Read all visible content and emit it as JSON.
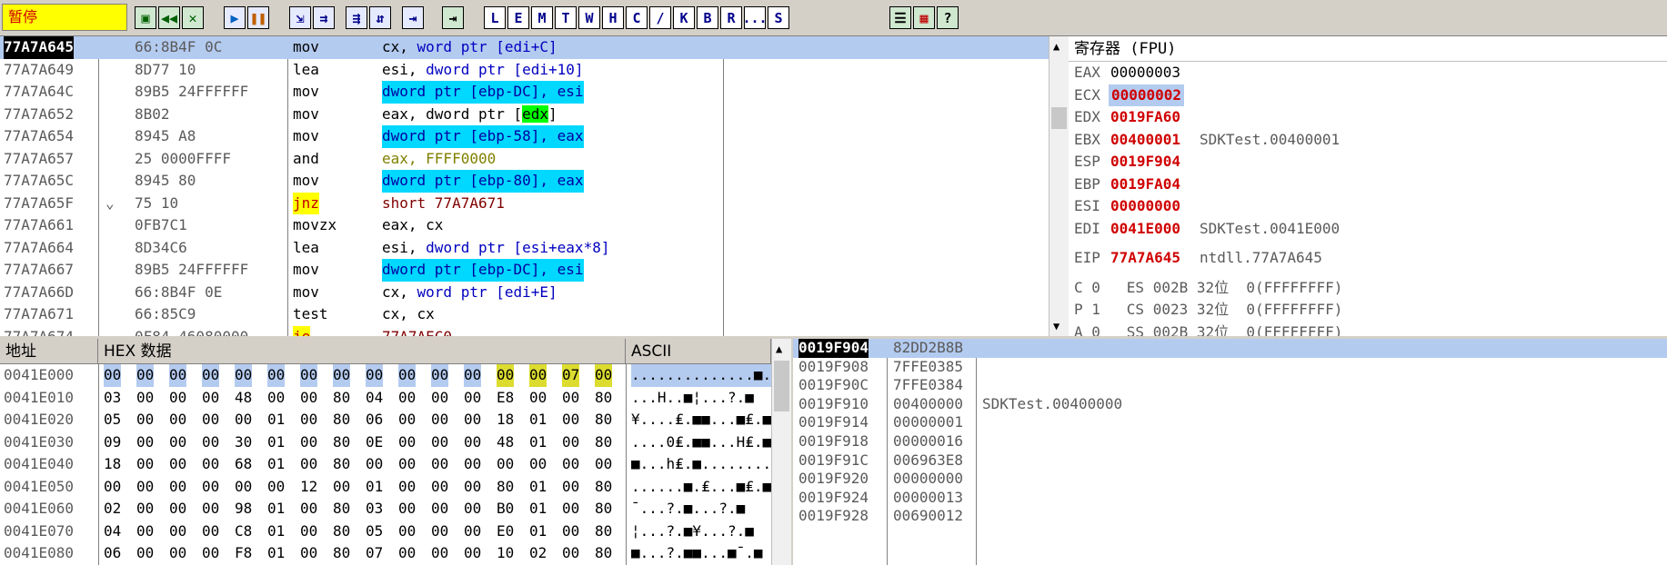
{
  "toolbar": {
    "status": "暂停",
    "buttons": [
      "L",
      "E",
      "M",
      "T",
      "W",
      "H",
      "C",
      "/",
      "K",
      "B",
      "R",
      "...",
      "S"
    ]
  },
  "disasm": {
    "rows": [
      {
        "addr": "77A7A645",
        "hex": "66:8B4F 0C",
        "mn": "mov",
        "op": "cx, word ptr [edi+C]"
      },
      {
        "addr": "77A7A649",
        "hex": "8D77 10",
        "mn": "lea",
        "op": "esi, dword ptr [edi+10]"
      },
      {
        "addr": "77A7A64C",
        "hex": "89B5 24FFFFFF",
        "mn": "mov",
        "op": "dword ptr [ebp-DC], esi"
      },
      {
        "addr": "77A7A652",
        "hex": "8B02",
        "mn": "mov",
        "op": "eax, dword ptr [edx]"
      },
      {
        "addr": "77A7A654",
        "hex": "8945 A8",
        "mn": "mov",
        "op": "dword ptr [ebp-58], eax"
      },
      {
        "addr": "77A7A657",
        "hex": "25 0000FFFF",
        "mn": "and",
        "op": "eax, FFFF0000"
      },
      {
        "addr": "77A7A65C",
        "hex": "8945 80",
        "mn": "mov",
        "op": "dword ptr [ebp-80], eax"
      },
      {
        "addr": "77A7A65F",
        "hex": "75 10",
        "mn": "jnz",
        "op": "short 77A7A671"
      },
      {
        "addr": "77A7A661",
        "hex": "0FB7C1",
        "mn": "movzx",
        "op": "eax, cx"
      },
      {
        "addr": "77A7A664",
        "hex": "8D34C6",
        "mn": "lea",
        "op": "esi, dword ptr [esi+eax*8]"
      },
      {
        "addr": "77A7A667",
        "hex": "89B5 24FFFFFF",
        "mn": "mov",
        "op": "dword ptr [ebp-DC], esi"
      },
      {
        "addr": "77A7A66D",
        "hex": "66:8B4F 0E",
        "mn": "mov",
        "op": "cx, word ptr [edi+E]"
      },
      {
        "addr": "77A7A671",
        "hex": "66:85C9",
        "mn": "test",
        "op": "cx, cx"
      },
      {
        "addr": "77A7A674",
        "hex": "0F84 46080000",
        "mn": "je",
        "op": "77A7AEC0"
      }
    ]
  },
  "registers": {
    "title": "寄存器 (FPU)",
    "eax": "EAX",
    "eax_v": "00000003",
    "ecx": "ECX",
    "ecx_v": "00000002",
    "edx": "EDX",
    "edx_v": "0019FA60",
    "ebx": "EBX",
    "ebx_v": "00400001",
    "ebx_c": "SDKTest.00400001",
    "esp": "ESP",
    "esp_v": "0019F904",
    "ebp": "EBP",
    "ebp_v": "0019FA04",
    "esi": "ESI",
    "esi_v": "00000000",
    "edi": "EDI",
    "edi_v": "0041E000",
    "edi_c": "SDKTest.0041E000",
    "eip": "EIP",
    "eip_v": "77A7A645",
    "eip_c": "ntdll.77A7A645",
    "seg1": "C 0   ES 002B 32位  0(FFFFFFFF)",
    "seg2": "P 1   CS 0023 32位  0(FFFFFFFF)",
    "seg3": "A 0   SS 002B 32位  0(FFFFFFFF)"
  },
  "dump": {
    "h_addr": "地址",
    "h_hex": "HEX 数据",
    "h_ascii": "ASCII",
    "rows": [
      {
        "a": "0041E000",
        "b": [
          "00",
          "00",
          "00",
          "00",
          "00",
          "00",
          "00",
          "00",
          "00",
          "00",
          "00",
          "00",
          "00",
          "00",
          "07",
          "00"
        ],
        "s": "..............■."
      },
      {
        "a": "0041E010",
        "b": [
          "03",
          "00",
          "00",
          "00",
          "48",
          "00",
          "00",
          "80",
          "04",
          "00",
          "00",
          "00",
          "E8",
          "00",
          "00",
          "80"
        ],
        "s": "...H..■¦...?.■"
      },
      {
        "a": "0041E020",
        "b": [
          "05",
          "00",
          "00",
          "00",
          "00",
          "01",
          "00",
          "80",
          "06",
          "00",
          "00",
          "00",
          "18",
          "01",
          "00",
          "80"
        ],
        "s": "¥....₤.■■...■₤.■"
      },
      {
        "a": "0041E030",
        "b": [
          "09",
          "00",
          "00",
          "00",
          "30",
          "01",
          "00",
          "80",
          "0E",
          "00",
          "00",
          "00",
          "48",
          "01",
          "00",
          "80"
        ],
        "s": "....0₤.■■...H₤.■"
      },
      {
        "a": "0041E040",
        "b": [
          "18",
          "00",
          "00",
          "00",
          "68",
          "01",
          "00",
          "80",
          "00",
          "00",
          "00",
          "00",
          "00",
          "00",
          "00",
          "00"
        ],
        "s": "■...h₤.■........"
      },
      {
        "a": "0041E050",
        "b": [
          "00",
          "00",
          "00",
          "00",
          "00",
          "00",
          "12",
          "00",
          "01",
          "00",
          "00",
          "00",
          "80",
          "01",
          "00",
          "80"
        ],
        "s": "......■.₤...■₤.■"
      },
      {
        "a": "0041E060",
        "b": [
          "02",
          "00",
          "00",
          "00",
          "98",
          "01",
          "00",
          "80",
          "03",
          "00",
          "00",
          "00",
          "B0",
          "01",
          "00",
          "80"
        ],
        "s": "¯...?.■...?.■"
      },
      {
        "a": "0041E070",
        "b": [
          "04",
          "00",
          "00",
          "00",
          "C8",
          "01",
          "00",
          "80",
          "05",
          "00",
          "00",
          "00",
          "E0",
          "01",
          "00",
          "80"
        ],
        "s": "¦...?.■¥...?.■"
      },
      {
        "a": "0041E080",
        "b": [
          "06",
          "00",
          "00",
          "00",
          "F8",
          "01",
          "00",
          "80",
          "07",
          "00",
          "00",
          "00",
          "10",
          "02",
          "00",
          "80"
        ],
        "s": "■...?.■■...■¯.■"
      }
    ]
  },
  "stack": {
    "rows": [
      {
        "a": "0019F904",
        "v": "82DD2B8B",
        "c": ""
      },
      {
        "a": "0019F908",
        "v": "7FFE0385",
        "c": ""
      },
      {
        "a": "0019F90C",
        "v": "7FFE0384",
        "c": ""
      },
      {
        "a": "0019F910",
        "v": "00400000",
        "c": "SDKTest.00400000"
      },
      {
        "a": "0019F914",
        "v": "00000001",
        "c": ""
      },
      {
        "a": "0019F918",
        "v": "00000016",
        "c": ""
      },
      {
        "a": "0019F91C",
        "v": "006963E8",
        "c": ""
      },
      {
        "a": "0019F920",
        "v": "00000000",
        "c": ""
      },
      {
        "a": "0019F924",
        "v": "00000013",
        "c": ""
      },
      {
        "a": "0019F928",
        "v": "00690012",
        "c": ""
      }
    ]
  }
}
